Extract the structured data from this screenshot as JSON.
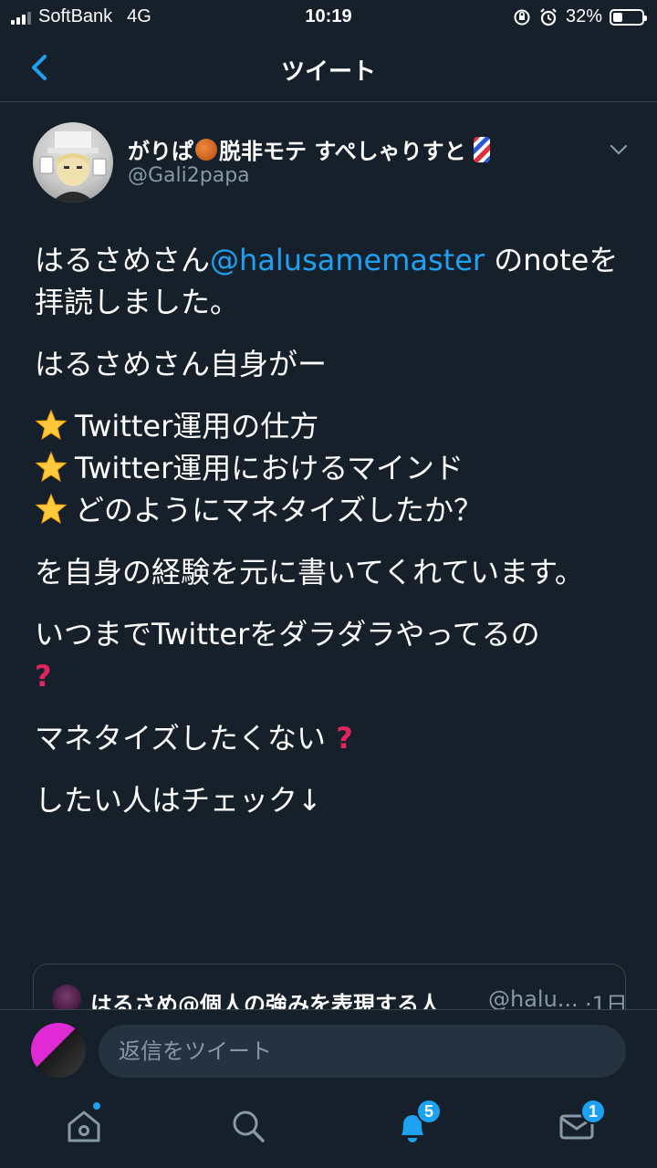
{
  "status_bar": {
    "carrier": "SoftBank",
    "network": "4G",
    "time": "10:19",
    "battery_percent": "32%",
    "battery_level": 0.32
  },
  "header": {
    "title": "ツイート",
    "back_icon": "chevron-left-icon"
  },
  "tweet": {
    "display_name": "がりぱ",
    "display_name_middle": "脱非モテ すぺしゃりすと",
    "handle": "@Gali2papa",
    "body": {
      "line1_before": "はるさめさん",
      "line1_mention": "@halusamemaster",
      "line1_after": " のnoteを拝読しました。",
      "line2": "はるさめさん自身がー",
      "bullet1": "Twitter運用の仕方",
      "bullet2": "Twitter運用におけるマインド",
      "bullet3": "どのようにマネタイズしたか？",
      "line3": "を自身の経験を元に書いてくれています。",
      "line4": "いつまでTwitterをダラダラやってるの",
      "line5": "マネタイズしたくない",
      "line6": "したい人はチェック↓"
    }
  },
  "quote": {
    "name": "はるさめ@個人の強みを表現する人",
    "handle": "@halu...",
    "time": "·1日"
  },
  "reply": {
    "placeholder": "返信をツイート"
  },
  "tabs": {
    "notifications_badge": "5",
    "messages_badge": "1"
  },
  "colors": {
    "background": "#15202b",
    "accent": "#1da1f2",
    "muted": "#8899a6",
    "divider": "#38444d"
  }
}
